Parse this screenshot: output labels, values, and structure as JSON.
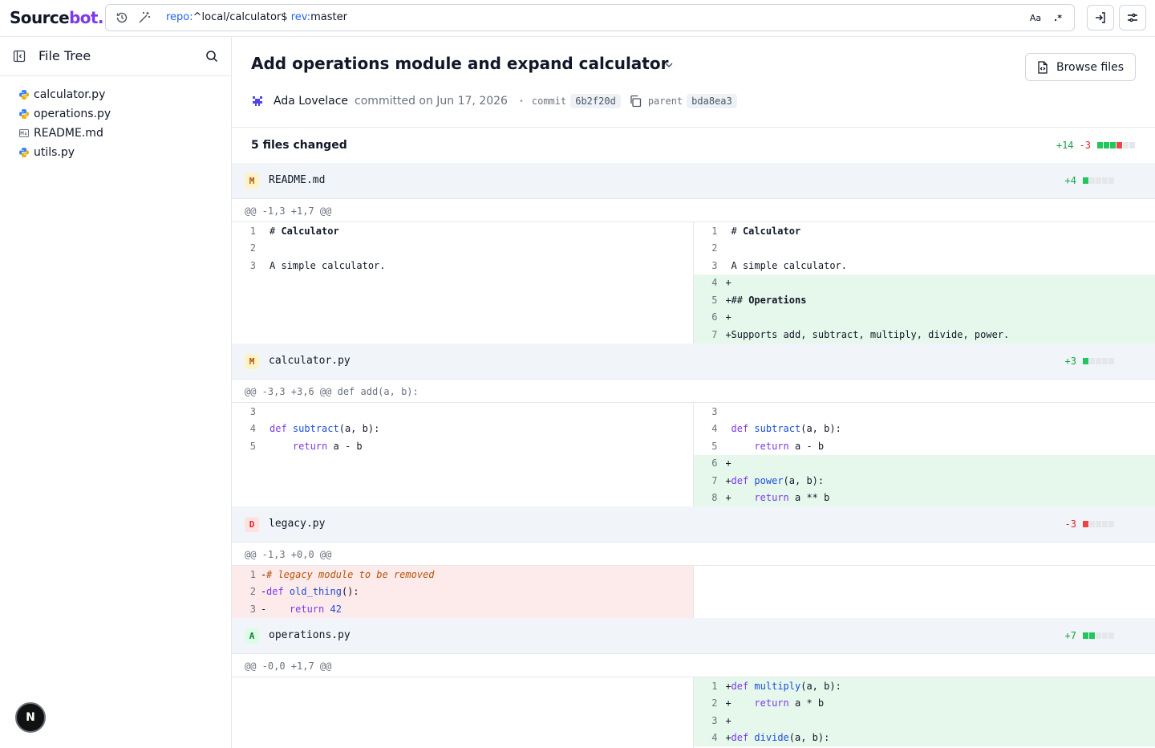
{
  "app": {
    "logo_main": "Source",
    "logo_accent": "bot."
  },
  "search": {
    "q1_key": "repo:",
    "q1_val": "^local/calculator$",
    "q2_key": "rev:",
    "q2_val": "master",
    "case_label": "Aa",
    "regex_label": ".*"
  },
  "sidebar": {
    "title": "File Tree",
    "files": [
      "calculator.py",
      "operations.py",
      "README.md",
      "utils.py"
    ],
    "n_badge": "N"
  },
  "commit": {
    "title": "Add operations module and expand calculator",
    "browse_label": "Browse files",
    "author": "Ada Lovelace",
    "committed_text": "committed on Jun 17, 2026",
    "commit_label": "commit",
    "commit_sha": "6b2f20d",
    "parent_label": "parent",
    "parent_sha": "bda8ea3"
  },
  "summary": {
    "title": "5 files changed",
    "additions": "+14",
    "deletions": "-3"
  },
  "files": [
    {
      "status": "M",
      "name": "README.md",
      "stat": "+4",
      "hunk": "@@ -1,3 +1,7 @@"
    },
    {
      "status": "M",
      "name": "calculator.py",
      "stat": "+3",
      "hunk": "@@ -3,3 +3,6 @@ def add(a, b):"
    },
    {
      "status": "D",
      "name": "legacy.py",
      "stat": "-3",
      "hunk": "@@ -1,3 +0,0 @@"
    },
    {
      "status": "A",
      "name": "operations.py",
      "stat": "+7",
      "hunk": "@@ -0,0 +1,7 @@"
    }
  ],
  "diff_text": {
    "readme_l1_hash": "# ",
    "readme_l1_word": "Calculator",
    "readme_l3": "A simple calculator.",
    "readme_r5_hash": "## ",
    "readme_r5_word": "Operations",
    "readme_r7": "Supports add, subtract, multiply, divide, power.",
    "calc_def": "def",
    "calc_subtract": "subtract",
    "calc_args": "(a, b):",
    "calc_return": "return",
    "calc_ret_expr": "a - b",
    "calc_power": "power",
    "calc_pow_expr": "a ** b",
    "legacy_comment": "# legacy module to be removed",
    "legacy_fn": "old_thing",
    "legacy_parens": "():",
    "legacy_return_val": "42",
    "ops_multiply": "multiply",
    "ops_mul_expr": "a * b",
    "ops_divide": "divide"
  },
  "line_numbers": [
    "1",
    "2",
    "3",
    "4",
    "5",
    "6",
    "7",
    "8"
  ],
  "markers": {
    "add": "+",
    "del": "-"
  }
}
